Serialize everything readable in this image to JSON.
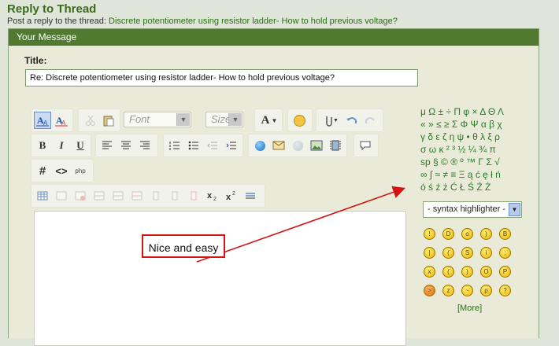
{
  "header": {
    "title": "Reply to Thread",
    "subtitle_prefix": "Post a reply to the thread:",
    "thread_link": "Discrete potentiometer using resistor ladder- How to hold previous voltage?"
  },
  "panel": {
    "title": "Your Message"
  },
  "form": {
    "title_label": "Title:",
    "title_value": "Re: Discrete potentiometer using resistor ladder- How to hold previous voltage?"
  },
  "toolbar": {
    "font_placeholder": "Font",
    "size_placeholder": "Size",
    "row1": [
      "font-style-icon",
      "remove-format-icon",
      "cut-icon",
      "paste-icon",
      "text-color-icon",
      "smiley-icon",
      "attachment-icon",
      "undo-icon",
      "redo-icon"
    ],
    "row2": [
      "bold",
      "italic",
      "underline",
      "align-left",
      "align-center",
      "align-right",
      "ordered-list",
      "unordered-list",
      "outdent",
      "indent",
      "link",
      "email",
      "unlink",
      "image",
      "video",
      "quote"
    ],
    "row3": [
      "wrap-code-icon",
      "wrap-html-icon",
      "wrap-php-icon"
    ],
    "row4": [
      "table-icon",
      "table-prop-icon",
      "delete-table-icon",
      "insert-row-icon",
      "delete-row-icon",
      "insert-col-icon",
      "delete-col-icon",
      "merge-icon",
      "subscript-icon",
      "superscript-icon",
      "hr-icon"
    ],
    "bold_glyph": "B",
    "italic_glyph": "I",
    "underline_glyph": "U",
    "code_glyph": "#",
    "html_glyph": "<>",
    "php_glyph": "php",
    "font_color_glyph": "A"
  },
  "annotation": {
    "text": "Nice and easy"
  },
  "special_chars": {
    "lines": [
      "μ Ω ± ÷ Π φ × Δ Θ Λ",
      "« » ≤ ≥ Σ Φ Ψ α β χ",
      "γ δ ε ζ η ψ • θ λ ξ ρ",
      "σ ω κ ² ³ ½ ¼ ¾ π",
      "sp § © ® º ™ Γ Σ √",
      "∞ ∫ ≈ ≠ ≡ Ξ ą ć ę ł ń",
      "ó ś ź ż Ć Ł Ś Ź Ż"
    ]
  },
  "syntax_select": {
    "value": "- syntax highlighter -"
  },
  "smilies": {
    "items": [
      "exclaim",
      "biggrin",
      "rolleyes",
      "smile",
      "cool",
      "neutral",
      "sad",
      "confused",
      "idea",
      "wink",
      "mad",
      "frown",
      "smile2",
      "eek",
      "tongue",
      "evil",
      "sleepy",
      "sigh",
      "razz",
      "question"
    ],
    "more_label": "[More]"
  },
  "colors": {
    "accent": "#4f7a2f",
    "link": "#2a6e14",
    "annotation": "#d21414"
  }
}
